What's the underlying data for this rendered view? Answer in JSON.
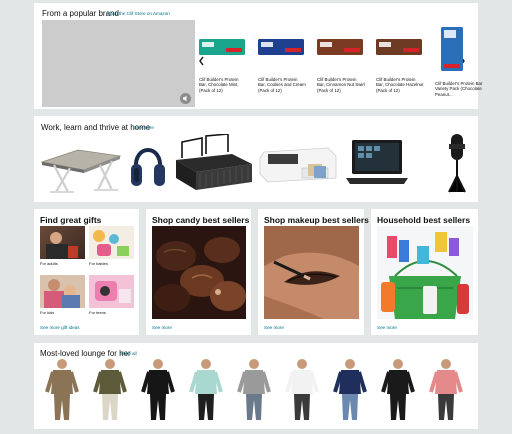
{
  "brand": {
    "title": "From a popular brand",
    "link": "Shop the Clif Store on Amazon",
    "products": [
      {
        "title": "Clif Builder's Protein Bar, Chocolate Mint, (Pack of 12)",
        "color": "#1aa58d",
        "icon": "protein-bar-mint-icon"
      },
      {
        "title": "Clif Builder's Protein Bar, Cookies and Cream (Pack of 12)",
        "color": "#1f3f8f",
        "icon": "protein-bar-cookies-icon"
      },
      {
        "title": "Clif Builder's Protein Bar, Cinnamon Nut Swirl (Pack of 12)",
        "color": "#7a3b22",
        "icon": "protein-bar-cinnamon-icon"
      },
      {
        "title": "Clif Builder's Protein Bar, Chocolate Hazelnut (Pack of 12)",
        "color": "#6d3a24",
        "icon": "protein-bar-hazelnut-icon"
      },
      {
        "title": "Clif Builder's Protein Bar Variety Pack (Chocolate Peanut...",
        "color": "#2a6fb8",
        "icon": "protein-bar-variety-pack-icon"
      }
    ]
  },
  "work": {
    "title": "Work, learn and thrive at home",
    "link": "See more",
    "items": [
      {
        "name": "laptop-table-image"
      },
      {
        "name": "headphones-image"
      },
      {
        "name": "desk-organizer-image"
      },
      {
        "name": "printer-image"
      },
      {
        "name": "laptop-image"
      },
      {
        "name": "microphone-image"
      }
    ]
  },
  "gifts": {
    "title": "Find great gifts",
    "tiles": [
      {
        "label": "For adults"
      },
      {
        "label": "For babies"
      },
      {
        "label": "For kids"
      },
      {
        "label": "For teens"
      }
    ],
    "link": "See more gift ideas"
  },
  "candy": {
    "title": "Shop candy best sellers",
    "link": "See more"
  },
  "makeup": {
    "title": "Shop makeup best sellers",
    "link": "See more"
  },
  "household": {
    "title": "Household best sellers",
    "link": "See more"
  },
  "lounge": {
    "title": "Most-loved lounge for her",
    "link": "Shop all",
    "items": [
      {
        "top": "#8b7355",
        "bottom": "#8b7355"
      },
      {
        "top": "#5d5a3a",
        "bottom": "#dcd6c8"
      },
      {
        "top": "#161616",
        "bottom": "#161616"
      },
      {
        "top": "#a8d8cf",
        "bottom": "#1e1e1e"
      },
      {
        "top": "#9a9a9a",
        "bottom": "#6a7a8a"
      },
      {
        "top": "#f2f2f2",
        "bottom": "#3a3a3a"
      },
      {
        "top": "#1f2e5a",
        "bottom": "#6a88b0"
      },
      {
        "top": "#1a1a1a",
        "bottom": "#1a1a1a"
      },
      {
        "top": "#e58a8a",
        "bottom": "#3a3a3a"
      }
    ]
  }
}
